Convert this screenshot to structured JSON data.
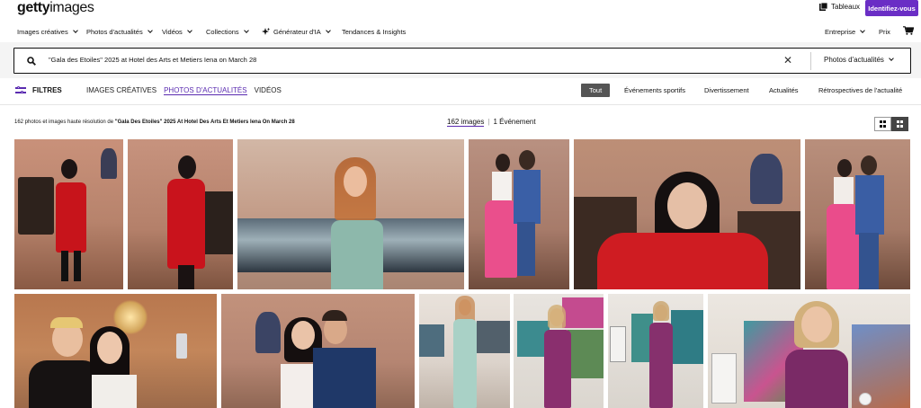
{
  "header": {
    "logo_bold": "getty",
    "logo_thin": "images",
    "boards_label": "Tableaux",
    "signin_label": "Identifiez-vous"
  },
  "nav": {
    "items": [
      {
        "label": "Images créatives",
        "dropdown": true
      },
      {
        "label": "Photos d'actualités",
        "dropdown": true
      },
      {
        "label": "Vidéos",
        "dropdown": true
      },
      {
        "label": "Collections",
        "dropdown": true
      },
      {
        "label": "Générateur d'IA",
        "dropdown": true
      },
      {
        "label": "Tendances & Insights",
        "dropdown": false
      }
    ],
    "right": [
      {
        "label": "Entreprise",
        "dropdown": true
      },
      {
        "label": "Prix",
        "dropdown": false
      }
    ],
    "icons": {
      "sparkle": "ai-sparkle-icon",
      "cart": "cart-icon",
      "boards": "boards-icon"
    }
  },
  "search": {
    "query": "\"Gala des Etoiles\" 2025 at Hotel des Arts et Metiers Iena on March 28",
    "clear": "✕",
    "scope": "Photos d'actualités"
  },
  "filters": {
    "label": "FILTRES",
    "media_tabs": [
      "IMAGES CRÉATIVES",
      "PHOTOS D'ACTUALITÉS",
      "VIDÉOS"
    ],
    "active_media_tab": 1,
    "chips": [
      "Tout",
      "Événements sportifs",
      "Divertissement",
      "Actualités",
      "Rétrospectives de l'actualité"
    ],
    "active_chip": 0
  },
  "results": {
    "summary_prefix": "162 photos et images haute résolution de ",
    "summary_bold": "\"Gala Des Etoiles\" 2025 At Hotel Des Arts Et Metiers Iena On March 28",
    "images_count": "162 images",
    "events_count": "1 Événement"
  },
  "colors": {
    "accent": "#6a2ec5",
    "chip_active": "#555555",
    "search_band": "#f4f4f4"
  },
  "gallery": {
    "row1": [
      {
        "name": "photo-woman-red-dress-fireplace"
      },
      {
        "name": "photo-woman-red-dress-pose"
      },
      {
        "name": "photo-woman-green-dress-painting"
      },
      {
        "name": "photo-couple-pink-gown-blue-suit"
      },
      {
        "name": "photo-woman-red-top-closeup"
      },
      {
        "name": "photo-couple-pink-gown-blue-suit-2"
      }
    ],
    "row2": [
      {
        "name": "photo-selfie-group"
      },
      {
        "name": "photo-couple-selfie-pose"
      },
      {
        "name": "photo-woman-mint-gown"
      },
      {
        "name": "photo-woman-purple-dress-art"
      },
      {
        "name": "photo-woman-purple-dress-art-2"
      },
      {
        "name": "photo-woman-purple-dress-smile"
      }
    ]
  }
}
